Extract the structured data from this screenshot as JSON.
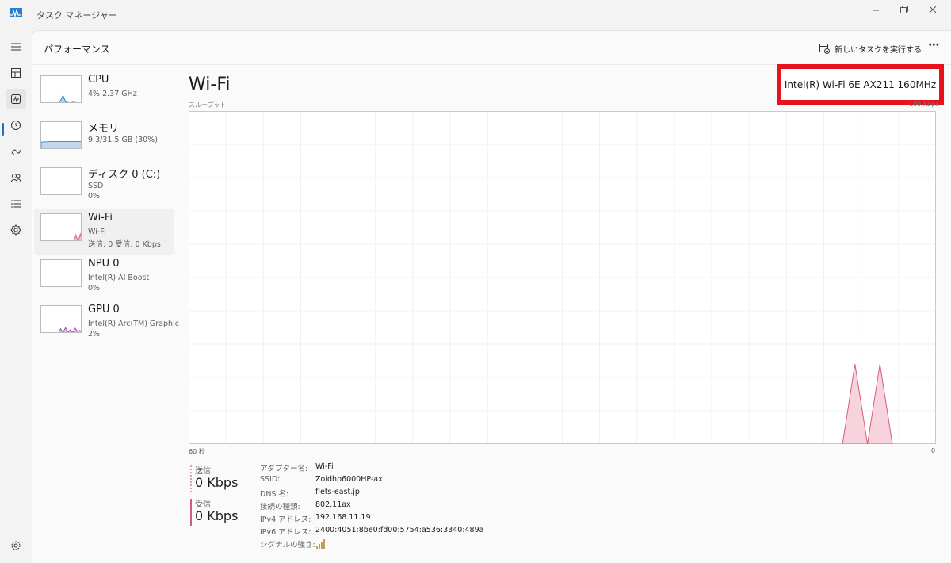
{
  "window": {
    "title": "タスク マネージャー"
  },
  "nav": {
    "items": [
      {
        "name": "menu-icon"
      },
      {
        "name": "processes-icon"
      },
      {
        "name": "performance-icon",
        "active": true
      },
      {
        "name": "app-history-icon"
      },
      {
        "name": "startup-apps-icon"
      },
      {
        "name": "users-icon"
      },
      {
        "name": "details-icon"
      },
      {
        "name": "services-icon"
      }
    ],
    "settings": {
      "name": "settings-icon"
    }
  },
  "header": {
    "title": "パフォーマンス",
    "run_task_label": "新しいタスクを実行する",
    "more_label": "⋯"
  },
  "devices": [
    {
      "name": "CPU",
      "sub1": "4%  2.37 GHz",
      "sub2": "",
      "color": "#1f89c7",
      "level": [
        3,
        4,
        3,
        3,
        5,
        3,
        4,
        3,
        12,
        30,
        8,
        5,
        4,
        6,
        5,
        4,
        3,
        4
      ]
    },
    {
      "name": "メモリ",
      "sub1": "9.3/31.5 GB (30%)",
      "sub2": "",
      "color": "#4a90d9",
      "level": [
        28,
        29,
        29,
        30,
        30,
        30,
        30,
        30,
        30,
        30,
        30,
        30,
        30,
        30,
        30,
        30,
        30,
        30
      ]
    },
    {
      "name": "ディスク 0 (C:)",
      "sub1": "SSD",
      "sub2": "0%",
      "color": "#4caf50",
      "level": [
        0,
        0,
        0,
        0,
        0,
        0,
        0,
        0,
        0,
        0,
        0,
        0,
        0,
        0,
        0,
        0,
        0,
        0
      ]
    },
    {
      "name": "Wi-Fi",
      "sub1": "Wi-Fi",
      "sub2": "送信: 0  受信: 0 Kbps",
      "color": "#d65c7a",
      "selected": true,
      "level": [
        0,
        0,
        0,
        0,
        0,
        0,
        0,
        0,
        0,
        0,
        0,
        0,
        0,
        0,
        0,
        0,
        25,
        0,
        28,
        0
      ]
    },
    {
      "name": "NPU 0",
      "sub1": "Intel(R) AI Boost",
      "sub2": "0%",
      "color": "#8a8a8a",
      "level": [
        0,
        0,
        0,
        0,
        0,
        0,
        0,
        0,
        0,
        0,
        0,
        0,
        0,
        0,
        0,
        0,
        0,
        0
      ]
    },
    {
      "name": "GPU 0",
      "sub1": "Intel(R) Arc(TM) Graphic",
      "sub2": "2%",
      "color": "#a24dc7",
      "level": [
        0,
        0,
        0,
        0,
        0,
        0,
        0,
        0,
        18,
        4,
        22,
        6,
        14,
        5,
        20,
        8,
        12,
        4
      ]
    }
  ],
  "main": {
    "title": "Wi-Fi",
    "adapter_name": "Intel(R) Wi-Fi 6E AX211 160MHz",
    "throughput_label": "スループット",
    "scale_label": "100 Kbps",
    "axis_left": "60 秒",
    "axis_right": "0",
    "send": {
      "label": "送信",
      "value": "0 Kbps",
      "color": "#c8a0b0"
    },
    "receive": {
      "label": "受信",
      "value": "0 Kbps",
      "color": "#d65c7a"
    },
    "details": [
      {
        "k": "アダプター名:",
        "v": "Wi-Fi"
      },
      {
        "k": "SSID:",
        "v": "Zoidhp6000HP-ax"
      },
      {
        "k": "DNS 名:",
        "v": "flets-east.jp"
      },
      {
        "k": "接続の種類:",
        "v": "802.11ax"
      },
      {
        "k": "IPv4 アドレス:",
        "v": "192.168.11.19"
      },
      {
        "k": "IPv6 アドレス:",
        "v": "2400:4051:8be0:fd00:5754:a536:3340:489a"
      },
      {
        "k": "シグナルの強さ:",
        "v": ""
      }
    ],
    "signal_strength_bars": 4,
    "graph_color": "#d65c7a",
    "graph_fill": "#f6d3dd"
  },
  "chart_data": {
    "type": "area",
    "title": "",
    "xlabel": "",
    "ylabel": "スループット",
    "x_range_seconds": [
      60,
      0
    ],
    "ylim": [
      0,
      100
    ],
    "series": [
      {
        "name": "受信",
        "values": [
          [
            7.5,
            0
          ],
          [
            6.5,
            24
          ],
          [
            5.5,
            0
          ],
          [
            4.5,
            24
          ],
          [
            3.5,
            0
          ]
        ]
      }
    ]
  }
}
